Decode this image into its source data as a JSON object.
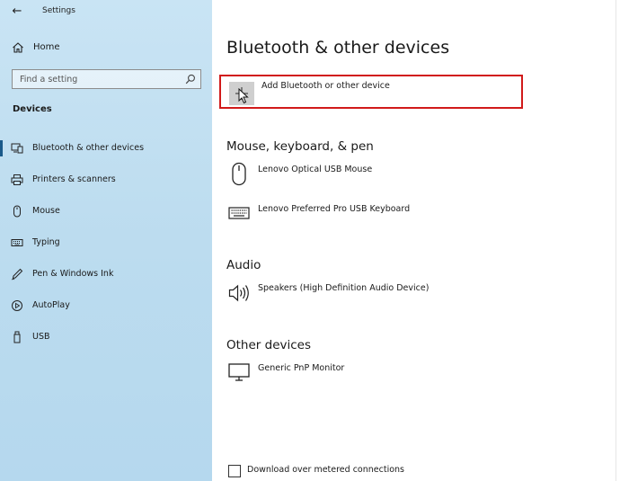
{
  "window": {
    "title": "Settings",
    "back_glyph": "←"
  },
  "sidebar": {
    "home_label": "Home",
    "search_placeholder": "Find a setting",
    "section_heading": "Devices",
    "items": [
      {
        "label": "Bluetooth & other devices",
        "icon": "bluetooth-devices-icon",
        "selected": true
      },
      {
        "label": "Printers & scanners",
        "icon": "printer-icon",
        "selected": false
      },
      {
        "label": "Mouse",
        "icon": "mouse-icon",
        "selected": false
      },
      {
        "label": "Typing",
        "icon": "keyboard-icon",
        "selected": false
      },
      {
        "label": "Pen & Windows Ink",
        "icon": "pen-icon",
        "selected": false
      },
      {
        "label": "AutoPlay",
        "icon": "autoplay-icon",
        "selected": false
      },
      {
        "label": "USB",
        "icon": "usb-icon",
        "selected": false
      }
    ]
  },
  "main": {
    "title": "Bluetooth & other devices",
    "add_device_label": "Add Bluetooth or other device",
    "groups": [
      {
        "heading": "Mouse, keyboard, & pen",
        "devices": [
          {
            "label": "Lenovo Optical USB Mouse",
            "icon": "mouse-icon"
          },
          {
            "label": "Lenovo Preferred Pro USB Keyboard",
            "icon": "keyboard-icon"
          }
        ]
      },
      {
        "heading": "Audio",
        "devices": [
          {
            "label": "Speakers (High Definition Audio Device)",
            "icon": "speaker-icon"
          }
        ]
      },
      {
        "heading": "Other devices",
        "devices": [
          {
            "label": "Generic PnP Monitor",
            "icon": "monitor-icon"
          }
        ]
      }
    ],
    "metered_label": "Download over metered connections",
    "metered_checked": false
  },
  "colors": {
    "highlight_border": "#d11a1a",
    "sidebar_bg": "#c2e0f2",
    "selected_indicator": "#1a5a8a"
  }
}
